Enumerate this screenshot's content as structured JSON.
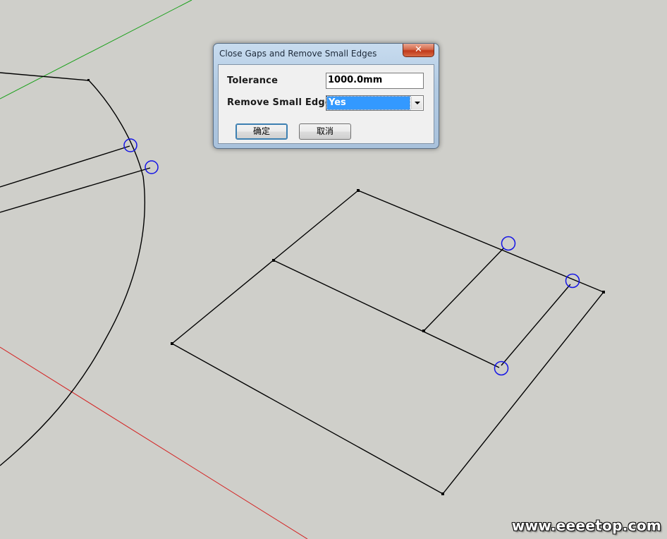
{
  "dialog": {
    "title": "Close Gaps and Remove Small Edges",
    "close_glyph": "✕",
    "tolerance_label": "Tolerance",
    "tolerance_value": "1000.0mm",
    "remove_small_edges_label": "Remove Small Edges",
    "remove_small_edges_value": "Yes",
    "ok_label": "确定",
    "cancel_label": "取消"
  },
  "watermark": "www.eeeetop.com",
  "colors": {
    "background": "#cfcfca",
    "edge": "#000000",
    "green_axis": "#18a018",
    "red_axis": "#d42020",
    "gap_marker": "#1414e6",
    "select_highlight": "#3399ff"
  }
}
